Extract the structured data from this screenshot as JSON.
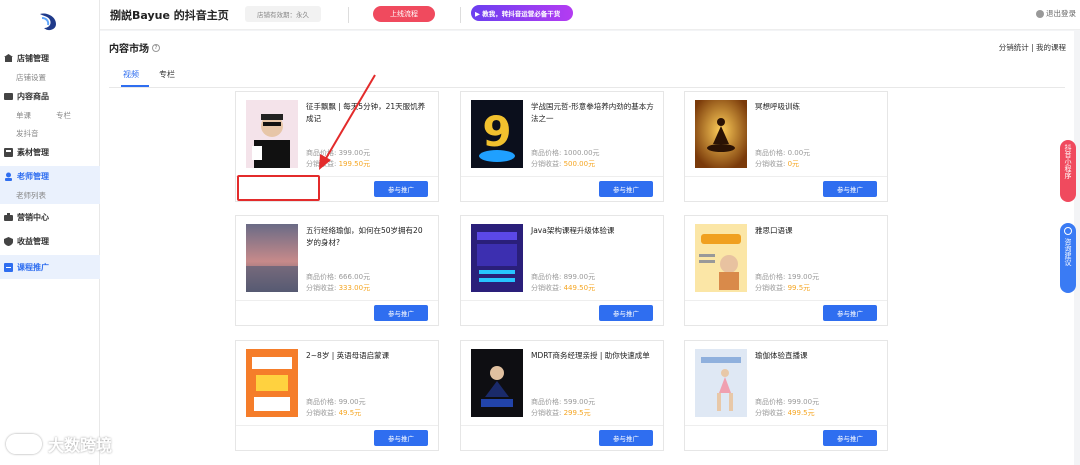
{
  "header": {
    "shop_title": "捌説Bayue 的抖音主页",
    "expire": "店铺有效期：永久",
    "launch_btn": "上线流程",
    "promo_banner": "▶ 教我，转抖音运营必备干货",
    "logout": "退出登录"
  },
  "sidebar": {
    "groups": [
      {
        "label": "店铺管理",
        "icon": "store-icon",
        "subs": [
          "店铺设置"
        ]
      },
      {
        "label": "内容商品",
        "icon": "content-icon",
        "subs": [
          "单课",
          "专栏",
          "发抖音"
        ]
      },
      {
        "label": "素材管理",
        "icon": "material-icon",
        "subs": []
      },
      {
        "label": "老师管理",
        "icon": "teacher-icon",
        "subs": [
          "老师列表"
        ],
        "active": true
      },
      {
        "label": "营销中心",
        "icon": "marketing-icon",
        "subs": []
      },
      {
        "label": "收益管理",
        "icon": "revenue-icon",
        "subs": []
      },
      {
        "label": "课程推广",
        "icon": "promote-icon",
        "subs": [],
        "active": true
      }
    ]
  },
  "main": {
    "title": "内容市场",
    "top_links": "分销统计 | 我的课程",
    "tabs": [
      "视频",
      "专栏"
    ],
    "active_tab": "视频",
    "price_label": "商品价格:",
    "earn_label": "分销收益:",
    "join_btn": "参与推广",
    "cards": [
      {
        "title": "征手飘飘 | 每天5分钟，21天服饥养成记",
        "price": "399.00元",
        "earn": "199.50元",
        "thumb": "man-cards"
      },
      {
        "title": "学战国元哲-形意拳培养内劲的基本方法之一",
        "price": "1000.00元",
        "earn": "500.00元",
        "thumb": "nine"
      },
      {
        "title": "冥想呼吸训练",
        "price": "0.00元",
        "earn": "0元",
        "thumb": "meditation"
      },
      {
        "title": "五行经络瑜伽，如何在50岁拥有20岁的身材?",
        "price": "666.00元",
        "earn": "333.00元",
        "thumb": "sunset"
      },
      {
        "title": "Java架构课程升级体验课",
        "price": "899.00元",
        "earn": "449.50元",
        "thumb": "java"
      },
      {
        "title": "雅思口语课",
        "price": "199.00元",
        "earn": "99.5元",
        "thumb": "ielts"
      },
      {
        "title": "2~8岁 | 英语母语启蒙课",
        "price": "99.00元",
        "earn": "49.5元",
        "thumb": "kids"
      },
      {
        "title": "MDRT商务经理亲授 | 助你快速成单",
        "price": "599.00元",
        "earn": "299.5元",
        "thumb": "mdrt"
      },
      {
        "title": "瑜伽体验直播课",
        "price": "999.00元",
        "earn": "499.5元",
        "thumb": "yoga"
      }
    ]
  },
  "float": {
    "mini_program": "抖音小程序",
    "suggest": "咨询建议"
  },
  "watermark": "大数跨境",
  "colors": {
    "accent": "#2f6ef0",
    "earn": "#f5a623",
    "highlight": "#e32b2b",
    "launch": "#f04a5e"
  }
}
